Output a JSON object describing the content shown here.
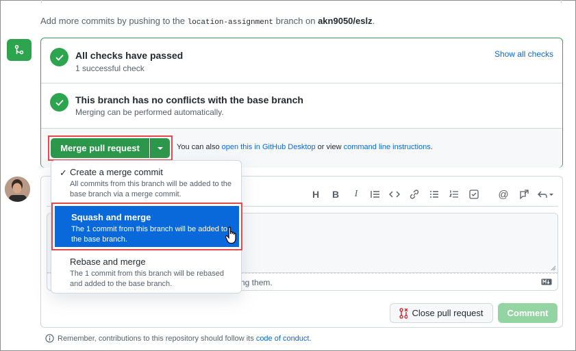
{
  "info_line": {
    "prefix": "Add more commits by pushing to the ",
    "branch": "location-assignment",
    "middle": " branch on ",
    "repo": "akn9050/eslz",
    "suffix": "."
  },
  "checks": {
    "title": "All checks have passed",
    "subtitle": "1 successful check",
    "show_all_label": "Show all checks"
  },
  "conflicts": {
    "title": "This branch has no conflicts with the base branch",
    "subtitle": "Merging can be performed automatically."
  },
  "merge": {
    "button_label": "Merge pull request",
    "also_prefix": "You can also ",
    "desktop_link": "open this in GitHub Desktop",
    "or_view": " or view ",
    "cli_link": "command line instructions",
    "also_suffix": "."
  },
  "merge_options": [
    {
      "title": "Create a merge commit",
      "description": "All commits from this branch will be added to the base branch via a merge commit.",
      "checked": true
    },
    {
      "title": "Squash and merge",
      "description": "The 1 commit from this branch will be added to the base branch.",
      "highlighted": true
    },
    {
      "title": "Rebase and merge",
      "description": "The 1 commit from this branch will be rebased and added to the base branch."
    }
  ],
  "toolbar": {
    "icons": [
      "heading-icon",
      "bold-icon",
      "italic-icon",
      "quote-icon",
      "code-icon",
      "link-icon",
      "bulleted-list-icon",
      "numbered-list-icon",
      "task-list-icon",
      "mention-icon",
      "reference-icon",
      "reply-icon"
    ]
  },
  "editor": {
    "footer_text": "ting them."
  },
  "actions": {
    "close_label": "Close pull request",
    "comment_label": "Comment"
  },
  "footer": {
    "prefix": "Remember, contributions to this repository should follow its ",
    "link": "code of conduct",
    "suffix": "."
  },
  "colors": {
    "success": "#2da44e",
    "link": "#0969da",
    "highlight": "#0969da",
    "annotation": "#e5474b",
    "comment_disabled": "#94d3a2"
  }
}
